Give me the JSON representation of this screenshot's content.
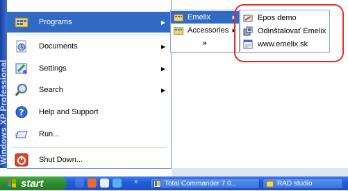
{
  "banner": {
    "text": "Windows XP Professional"
  },
  "start_menu": {
    "items": [
      {
        "label": "Programs",
        "icon": "programs-icon",
        "has_submenu": true
      },
      {
        "label": "Documents",
        "icon": "documents-icon",
        "has_submenu": true
      },
      {
        "label": "Settings",
        "icon": "settings-icon",
        "has_submenu": true
      },
      {
        "label": "Search",
        "icon": "search-icon",
        "has_submenu": true
      },
      {
        "label": "Help and Support",
        "icon": "help-icon",
        "has_submenu": false
      },
      {
        "label": "Run...",
        "icon": "run-icon",
        "has_submenu": false
      },
      {
        "label": "Shut Down...",
        "icon": "shutdown-icon",
        "has_submenu": false
      }
    ]
  },
  "programs_menu": {
    "items": [
      {
        "label": "Emelix",
        "icon": "folder-icon"
      },
      {
        "label": "Accessories",
        "icon": "folder-icon"
      }
    ],
    "expand_glyph": "»"
  },
  "emelix_menu": {
    "items": [
      {
        "label": "Epos demo",
        "icon": "app-icon"
      },
      {
        "label": "Odinštalovať Emelix",
        "icon": "uninstall-icon"
      },
      {
        "label": "www.emelix.sk",
        "icon": "web-link-icon"
      }
    ]
  },
  "taskbar": {
    "start_label": "start",
    "tasks": [
      {
        "label": "Total Commander 7.0...",
        "icon": "total-commander-icon"
      },
      {
        "label": "RAD studio",
        "icon": "folder-icon"
      }
    ],
    "more_glyph": "»"
  },
  "colors": {
    "highlight": "#316ac5",
    "callout": "#e32b2b",
    "start_button": "#2e8b2e",
    "taskbar": "#245edb"
  }
}
